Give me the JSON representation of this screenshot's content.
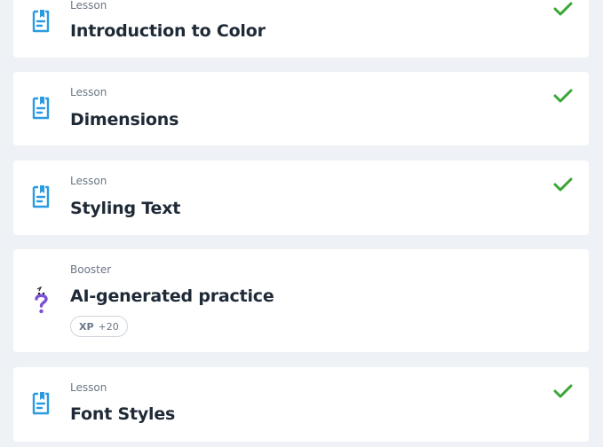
{
  "items": [
    {
      "type": "Lesson",
      "title": "Introduction to Color",
      "completed": true,
      "icon": "lesson-icon"
    },
    {
      "type": "Lesson",
      "title": "Dimensions",
      "completed": true,
      "icon": "lesson-icon"
    },
    {
      "type": "Lesson",
      "title": "Styling Text",
      "completed": true,
      "icon": "lesson-icon"
    },
    {
      "type": "Booster",
      "title": "AI-generated practice",
      "completed": false,
      "icon": "question-mark-icon",
      "xp_label": "XP",
      "xp_value": "+20"
    },
    {
      "type": "Lesson",
      "title": "Font Styles",
      "completed": true,
      "icon": "lesson-icon"
    }
  ],
  "colors": {
    "lesson_icon": "#2b9be0",
    "booster_icon": "#7b4fd6",
    "check": "#3aa636",
    "background": "#eef1f5",
    "card": "#ffffff"
  }
}
